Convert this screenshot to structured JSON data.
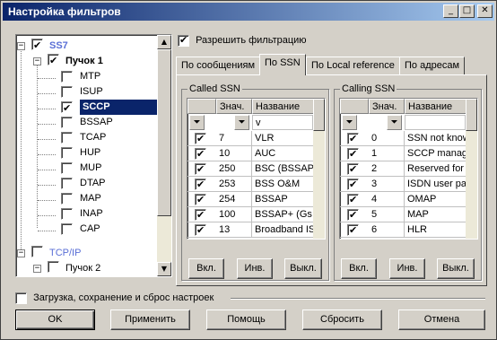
{
  "window": {
    "title": "Настройка фильтров",
    "controls": [
      "_",
      "□",
      "✕"
    ]
  },
  "tree": {
    "nodes": [
      {
        "label": "SS7",
        "checked": true,
        "expander": "−",
        "style": "link"
      },
      {
        "label": "Пучок 1",
        "checked": true,
        "expander": "−",
        "style": "bold"
      },
      {
        "label": "MTP",
        "checked": false
      },
      {
        "label": "ISUP",
        "checked": false
      },
      {
        "label": "SCCP",
        "checked": true,
        "selected": true
      },
      {
        "label": "BSSAP",
        "checked": false
      },
      {
        "label": "TCAP",
        "checked": false
      },
      {
        "label": "HUP",
        "checked": false
      },
      {
        "label": "MUP",
        "checked": false
      },
      {
        "label": "DTAP",
        "checked": false
      },
      {
        "label": "MAP",
        "checked": false
      },
      {
        "label": "INAP",
        "checked": false
      },
      {
        "label": "CAP",
        "checked": false
      },
      {
        "label": "TCP/IP",
        "checked": false,
        "expander": "−",
        "style": "link"
      },
      {
        "label": "Пучок 2",
        "checked": false,
        "expander": "−"
      }
    ]
  },
  "enable_filter": {
    "label": "Разрешить фильтрацию",
    "checked": true
  },
  "tabs": [
    {
      "label": "По сообщениям",
      "active": false
    },
    {
      "label": "По SSN",
      "active": true
    },
    {
      "label": "По Local reference",
      "active": false
    },
    {
      "label": "По адресам",
      "active": false
    }
  ],
  "called": {
    "title": "Called SSN",
    "col_value": "Знач.",
    "col_name": "Название",
    "filter_text": "v",
    "rows": [
      {
        "checked": true,
        "value": "7",
        "name": "VLR"
      },
      {
        "checked": true,
        "value": "10",
        "name": "AUC"
      },
      {
        "checked": true,
        "value": "250",
        "name": "BSC (BSSAP-"
      },
      {
        "checked": true,
        "value": "253",
        "name": "BSS O&M"
      },
      {
        "checked": true,
        "value": "254",
        "name": "BSSAP"
      },
      {
        "checked": true,
        "value": "100",
        "name": "BSSAP+ (Gs i"
      },
      {
        "checked": true,
        "value": "13",
        "name": "Broadband IS"
      }
    ],
    "buttons": [
      "Вкл.",
      "Инв.",
      "Выкл."
    ]
  },
  "calling": {
    "title": "Calling SSN",
    "col_value": "Знач.",
    "col_name": "Название",
    "filter_text": "",
    "rows": [
      {
        "checked": true,
        "value": "0",
        "name": "SSN not know"
      },
      {
        "checked": true,
        "value": "1",
        "name": "SCCP manag"
      },
      {
        "checked": true,
        "value": "2",
        "name": "Reserved for"
      },
      {
        "checked": true,
        "value": "3",
        "name": "ISDN user pa"
      },
      {
        "checked": true,
        "value": "4",
        "name": "OMAP"
      },
      {
        "checked": true,
        "value": "5",
        "name": "MAP"
      },
      {
        "checked": true,
        "value": "6",
        "name": "HLR"
      }
    ],
    "buttons": [
      "Вкл.",
      "Инв.",
      "Выкл."
    ]
  },
  "save_section": {
    "label": "Загрузка, сохранение и сброс настроек",
    "checked": false
  },
  "footer": {
    "ok": "OK",
    "apply": "Применить",
    "help": "Помощь",
    "reset": "Сбросить",
    "cancel": "Отмена"
  },
  "colors": {
    "title_start": "#0a246a",
    "title_end": "#a6caf0",
    "selection": "#0a246a",
    "link": "#5a6fd6"
  }
}
